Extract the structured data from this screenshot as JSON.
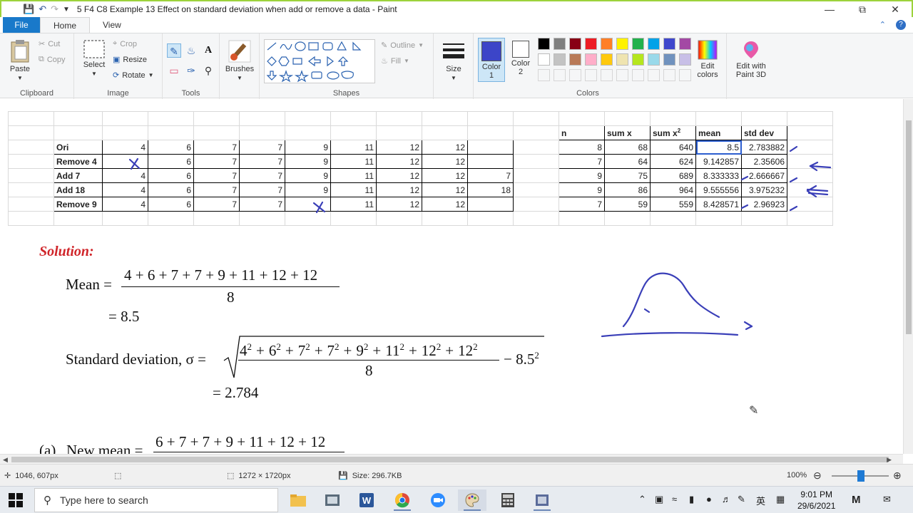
{
  "window": {
    "title": "5 F4 C8 Example 13 Effect on standard deviation when add or remove a data - Paint"
  },
  "menu": {
    "file": "File",
    "tabs": [
      "Home",
      "View"
    ]
  },
  "ribbon": {
    "clipboard": {
      "label": "Clipboard",
      "paste": "Paste",
      "cut": "Cut",
      "copy": "Copy"
    },
    "image": {
      "label": "Image",
      "select": "Select",
      "crop": "Crop",
      "resize": "Resize",
      "rotate": "Rotate"
    },
    "tools": {
      "label": "Tools"
    },
    "brushes": {
      "label": "Brushes"
    },
    "shapes": {
      "label": "Shapes",
      "outline": "Outline",
      "fill": "Fill"
    },
    "size": {
      "label": "Size"
    },
    "colors": {
      "label": "Colors",
      "color1": "Color",
      "color1_num": "1",
      "color2": "Color",
      "color2_num": "2",
      "edit_colors_1": "Edit",
      "edit_colors_2": "colors",
      "paint3d_1": "Edit with",
      "paint3d_2": "Paint 3D",
      "color1_value": "#3c45c8",
      "palette_row1": [
        "#000000",
        "#7f7f7f",
        "#880015",
        "#ed1c24",
        "#ff7f27",
        "#fff200",
        "#22b14c",
        "#00a2e8",
        "#3f48cc",
        "#a349a4"
      ],
      "palette_row2": [
        "#ffffff",
        "#c3c3c3",
        "#b97a57",
        "#ffaec9",
        "#ffc90e",
        "#efe4b0",
        "#b5e61d",
        "#99d9ea",
        "#7092be",
        "#c8bfe7"
      ]
    }
  },
  "sheet": {
    "right_headers": [
      "n",
      "sum x",
      "sum x",
      "mean",
      "std dev"
    ],
    "sup2": "2",
    "rows": [
      {
        "label": "Ori",
        "values": [
          "4",
          "6",
          "7",
          "7",
          "9",
          "11",
          "12",
          "12",
          ""
        ],
        "n": "8",
        "sumx": "68",
        "sumx2": "640",
        "mean": "8.5",
        "sd": "2.783882"
      },
      {
        "label": "Remove 4",
        "values": [
          "",
          "6",
          "7",
          "7",
          "9",
          "11",
          "12",
          "12",
          ""
        ],
        "n": "7",
        "sumx": "64",
        "sumx2": "624",
        "mean": "9.142857",
        "sd": "2.35606"
      },
      {
        "label": "Add 7",
        "values": [
          "4",
          "6",
          "7",
          "7",
          "9",
          "11",
          "12",
          "12",
          "7"
        ],
        "n": "9",
        "sumx": "75",
        "sumx2": "689",
        "mean": "8.333333",
        "sd": "2.666667"
      },
      {
        "label": "Add 18",
        "values": [
          "4",
          "6",
          "7",
          "7",
          "9",
          "11",
          "12",
          "12",
          "18"
        ],
        "n": "9",
        "sumx": "86",
        "sumx2": "964",
        "mean": "9.555556",
        "sd": "3.975232"
      },
      {
        "label": "Remove 9",
        "values": [
          "4",
          "6",
          "7",
          "7",
          "",
          "11",
          "12",
          "12",
          ""
        ],
        "n": "7",
        "sumx": "59",
        "sumx2": "559",
        "mean": "8.428571",
        "sd": "2.96923"
      }
    ]
  },
  "solution": {
    "heading": "Solution:",
    "mean_label": "Mean =",
    "mean_numerator": "4 + 6 + 7 + 7 + 9 + 11 + 12 + 12",
    "mean_denominator": "8",
    "mean_result": "= 8.5",
    "sd_label": "Standard deviation, σ =",
    "sd_numerator_terms": [
      "4",
      "6",
      "7",
      "7",
      "9",
      "11",
      "12",
      "12"
    ],
    "sd_plus": "+",
    "sd_denominator": "8",
    "sd_minus": "−",
    "sd_mean": "8.5",
    "sup2": "2",
    "sd_result": "= 2.784",
    "part_a_label": "(a)",
    "part_a_text": "New mean =",
    "part_a_numerator": "6 + 7 + 7 + 9 + 11 + 12 + 12"
  },
  "status": {
    "cursor": "1046, 607px",
    "dimensions": "1272 × 1720px",
    "size": "Size: 296.7KB",
    "zoom": "100%"
  },
  "taskbar": {
    "search_placeholder": "Type here to search",
    "lang": "英",
    "time": "9:01 PM",
    "date": "29/6/2021"
  },
  "annotation_color": "#3a3fb8"
}
